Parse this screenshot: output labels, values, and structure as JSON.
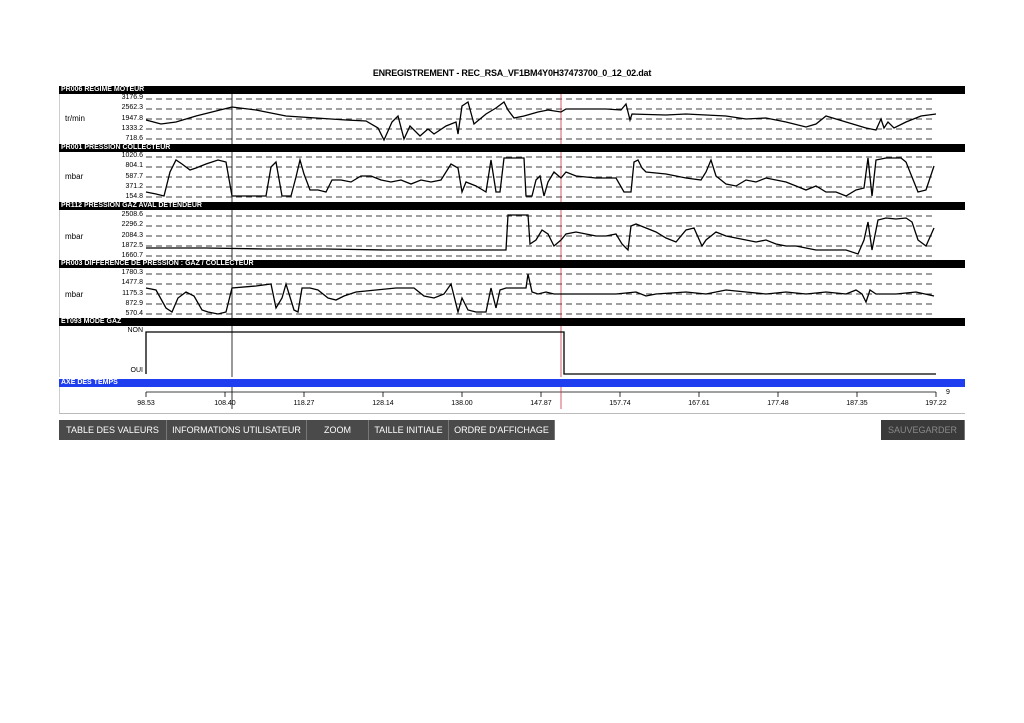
{
  "window": {
    "title": "ENREGISTREMENT - REC_RSA_VF1BM4Y0H37473700_0_12_02.dat"
  },
  "panels": [
    {
      "label": "PR006 REGIME MOTEUR",
      "unit": "tr/min",
      "ticks": [
        "3176.9",
        "2562.3",
        "1947.8",
        "1333.2",
        "718.6"
      ]
    },
    {
      "label": "PR001 PRESSION COLLECTEUR",
      "unit": "mbar",
      "ticks": [
        "1020.6",
        "804.1",
        "587.7",
        "371.2",
        "154.8"
      ]
    },
    {
      "label": "PR112 PRESSION GAZ AVAL DETENDEUR",
      "unit": "mbar",
      "ticks": [
        "2508.6",
        "2296.2",
        "2084.3",
        "1872.5",
        "1660.7"
      ]
    },
    {
      "label": "PR003 DIFFERENCE DE PRESSION : GAZ / COLLECTEUR",
      "unit": "mbar",
      "ticks": [
        "1780.3",
        "1477.8",
        "1175.3",
        "872.9",
        "570.4"
      ]
    },
    {
      "label": "ET093 MODE GAZ",
      "unit": "",
      "ticks": [
        "NON",
        "OUI"
      ]
    }
  ],
  "time_axis": {
    "label": "AXE DES TEMPS",
    "ticks": [
      "98.53",
      "108.40",
      "118.27",
      "128.14",
      "138.00",
      "147.87",
      "157.74",
      "167.61",
      "177.48",
      "187.35",
      "197.22"
    ],
    "overflow_tick": "9"
  },
  "toolbar": {
    "table": "TABLE DES VALEURS",
    "info": "INFORMATIONS UTILISATEUR",
    "zoom": "ZOOM",
    "taille": "TAILLE INITIALE",
    "ordre": "ORDRE D'AFFICHAGE",
    "save": "SAUVEGARDER"
  },
  "colors": {
    "header_bg": "#000000",
    "time_header_bg": "#1f3ef0",
    "cursor_black": "#000000",
    "cursor_red": "#cc3344",
    "button_bg": "#4a4a4a"
  }
}
